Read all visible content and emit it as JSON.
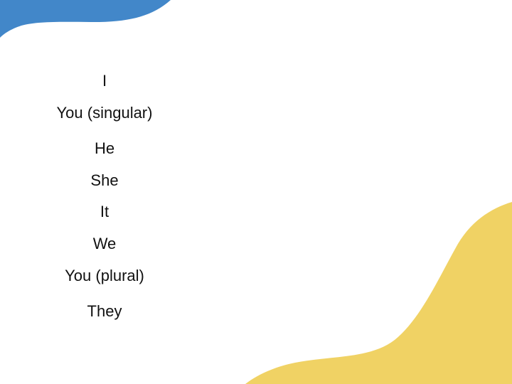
{
  "colors": {
    "background": "#ffffff",
    "top_left_shape": "#4287c9",
    "bottom_right_shape": "#f0d264",
    "text": "#111111"
  },
  "pronouns": [
    "I",
    "You (singular)",
    "He",
    "She",
    "It",
    "We",
    "You (plural)",
    "They"
  ]
}
